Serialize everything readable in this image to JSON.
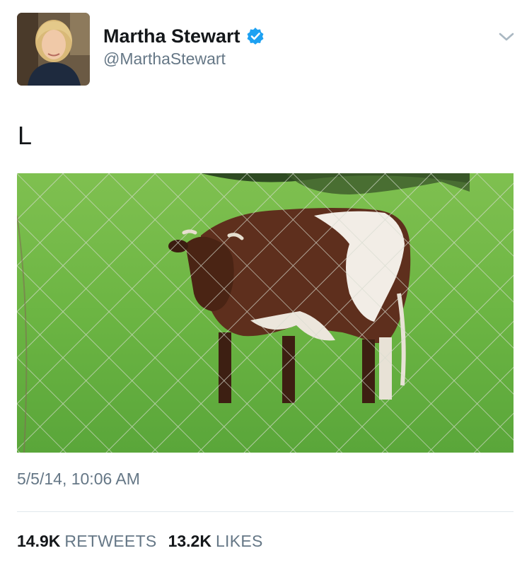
{
  "user": {
    "display_name": "Martha Stewart",
    "handle": "@MarthaStewart",
    "verified_icon": "verified-badge-icon",
    "avatar_icon": "profile-photo"
  },
  "menu": {
    "icon": "chevron-down-icon"
  },
  "tweet": {
    "text": "L",
    "photo": "photo-of-brown-and-white-cow-behind-chain-link-fence",
    "timestamp": "5/5/14, 10:06 AM"
  },
  "stats": {
    "retweets_count": "14.9K",
    "retweets_label": "RETWEETS",
    "likes_count": "13.2K",
    "likes_label": "LIKES"
  },
  "colors": {
    "verified_blue": "#1da1f2",
    "secondary_text": "#657786",
    "divider": "#e1e8ed"
  }
}
